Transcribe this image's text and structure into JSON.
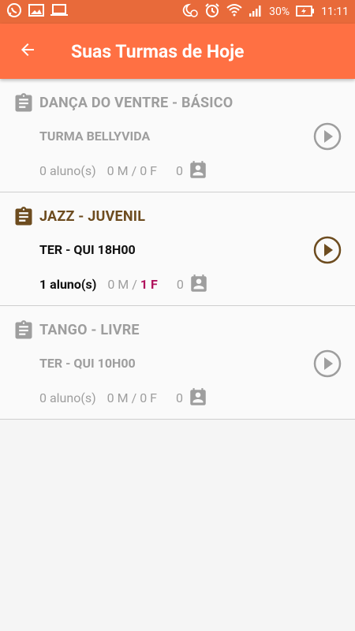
{
  "status_bar": {
    "battery": "30%",
    "time": "11:11"
  },
  "header": {
    "title": "Suas Turmas de Hoje"
  },
  "classes": [
    {
      "title": "DANÇA DO VENTRE - BÁSICO",
      "subtitle": "TURMA BELLYVIDA",
      "students": "0 aluno(s)",
      "male": "0 M",
      "sep": "/",
      "female": "0 F",
      "count": "0",
      "active": false
    },
    {
      "title": "JAZZ - JUVENIL",
      "subtitle": "TER - QUI 18H00",
      "students": "1 aluno(s)",
      "male": "0 M",
      "sep": "/",
      "female": "1 F",
      "count": "0",
      "active": true
    },
    {
      "title": "TANGO - LIVRE",
      "subtitle": "TER - QUI 10H00",
      "students": "0 aluno(s)",
      "male": "0 M",
      "sep": "/",
      "female": "0 F",
      "count": "0",
      "active": false
    }
  ],
  "colors": {
    "status_bar": "#e86a3a",
    "app_bar": "#ff7043",
    "active_accent": "#6d4c1f",
    "female_highlight": "#b0125c",
    "inactive": "#9e9e9e"
  }
}
